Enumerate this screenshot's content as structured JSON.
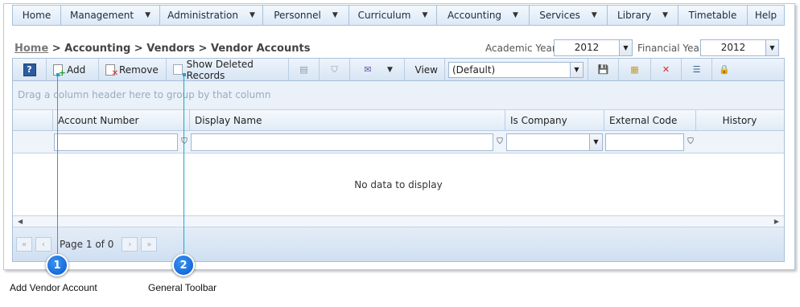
{
  "menu": [
    {
      "label": "Home",
      "dropdown": false
    },
    {
      "label": "Management",
      "dropdown": true
    },
    {
      "label": "Administration",
      "dropdown": true
    },
    {
      "label": "Personnel",
      "dropdown": true
    },
    {
      "label": "Curriculum",
      "dropdown": true
    },
    {
      "label": "Accounting",
      "dropdown": true
    },
    {
      "label": "Services",
      "dropdown": true
    },
    {
      "label": "Library",
      "dropdown": true
    },
    {
      "label": "Timetable",
      "dropdown": false
    },
    {
      "label": "Help",
      "dropdown": false
    }
  ],
  "breadcrumb": {
    "home": "Home",
    "rest": " > Accounting > Vendors > Vendor Accounts"
  },
  "academic_year": {
    "label": "Academic Year",
    "value": "2012"
  },
  "financial_year": {
    "label": "Financial Year",
    "value": "2012"
  },
  "toolbar": {
    "add_label": "Add",
    "remove_label": "Remove",
    "show_deleted_label": "Show Deleted Records",
    "view_label": "View",
    "view_value": "(Default)"
  },
  "grid": {
    "group_hint": "Drag a column header here to group by that column",
    "columns": [
      "Account Number",
      "Display Name",
      "Is Company",
      "External Code",
      "History"
    ],
    "empty_text": "No data to display",
    "pager_text": "Page 1 of 0"
  },
  "callouts": [
    {
      "number": "1",
      "label": "Add Vendor Account"
    },
    {
      "number": "2",
      "label": "General Toolbar"
    }
  ],
  "colors": {
    "accent": "#0a5ad3",
    "callout_line": "#1aa6c9",
    "header_bg": "#dce9f6"
  }
}
